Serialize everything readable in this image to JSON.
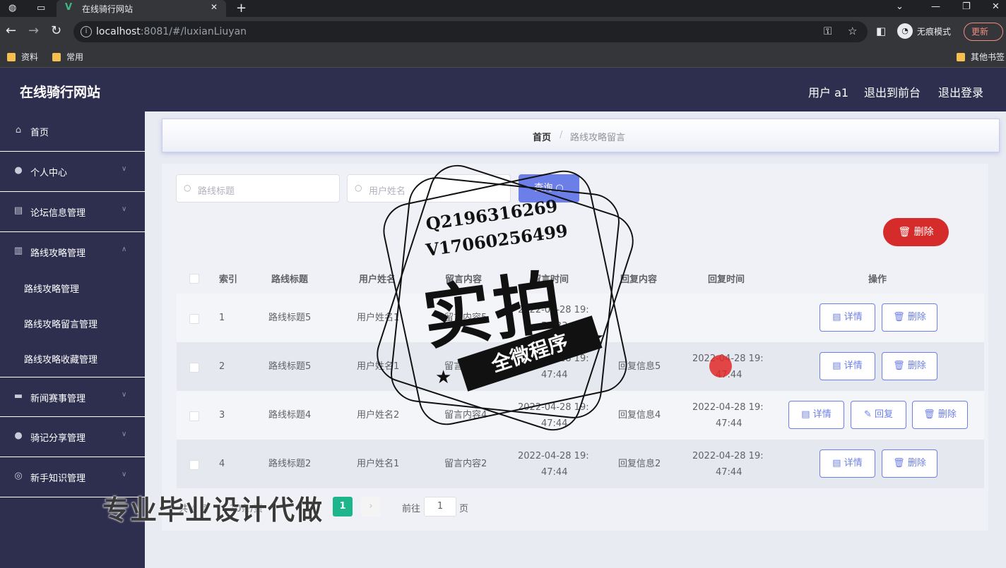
{
  "browser": {
    "tab_title": "在线骑行网站",
    "url_host": "localhost",
    "url_rest": ":8081/#/luxianLiuyan",
    "incognito_label": "无痕模式",
    "update_label": "更新",
    "bookmarks": [
      "资料",
      "常用"
    ],
    "other_bookmarks": "其他书签"
  },
  "header": {
    "site_title": "在线骑行网站",
    "user": "用户 a1",
    "to_front": "退出到前台",
    "logout": "退出登录"
  },
  "sidebar": {
    "items": [
      {
        "label": "首页",
        "icon": "home-icon"
      },
      {
        "label": "个人中心",
        "icon": "user-icon"
      },
      {
        "label": "论坛信息管理",
        "icon": "briefcase-icon"
      },
      {
        "label": "路线攻略管理",
        "icon": "book-icon"
      },
      {
        "label": "新闻赛事管理",
        "icon": "chat-icon"
      },
      {
        "label": "骑记分享管理",
        "icon": "bulb-icon"
      },
      {
        "label": "新手知识管理",
        "icon": "compass-icon"
      }
    ],
    "subitems": [
      "路线攻略管理",
      "路线攻略留言管理",
      "路线攻略收藏管理"
    ]
  },
  "breadcrumb": {
    "home": "首页",
    "separator": "/",
    "current": "路线攻略留言"
  },
  "search": {
    "title_placeholder": "路线标题",
    "user_placeholder": "用户姓名",
    "query_label": "查询",
    "delete_label": "删除"
  },
  "table": {
    "headers": [
      "索引",
      "路线标题",
      "用户姓名",
      "留言内容",
      "留言时间",
      "回复内容",
      "回复时间",
      "操作"
    ],
    "rows": [
      {
        "index": "1",
        "title": "路线标题5",
        "user": "用户姓名1",
        "message": "留言内容5",
        "msg_time_1": "2022-04-28 19:",
        "msg_time_2": "56:33",
        "reply": "",
        "reply_time_1": "",
        "reply_time_2": "",
        "buttons": [
          "详情",
          "删除"
        ]
      },
      {
        "index": "2",
        "title": "路线标题5",
        "user": "用户姓名1",
        "message": "留言内容5",
        "msg_time_1": "2022-04-28 19:",
        "msg_time_2": "47:44",
        "reply": "回复信息5",
        "reply_time_1": "2022-04-28 19:",
        "reply_time_2": "47:44",
        "buttons": [
          "详情",
          "删除"
        ]
      },
      {
        "index": "3",
        "title": "路线标题4",
        "user": "用户姓名2",
        "message": "留言内容4",
        "msg_time_1": "2022-04-28 19:",
        "msg_time_2": "47:44",
        "reply": "回复信息4",
        "reply_time_1": "2022-04-28 19:",
        "reply_time_2": "47:44",
        "buttons": [
          "详情",
          "回复",
          "删除"
        ]
      },
      {
        "index": "4",
        "title": "路线标题2",
        "user": "用户姓名1",
        "message": "留言内容2",
        "msg_time_1": "2022-04-28 19:",
        "msg_time_2": "47:44",
        "reply": "回复信息2",
        "reply_time_1": "2022-04-28 19:",
        "reply_time_2": "47:44",
        "buttons": [
          "详情",
          "删除"
        ]
      }
    ]
  },
  "pager": {
    "total": "共 4 条",
    "page_size": "10条/页",
    "current": "1",
    "goto": "前往",
    "goto_value": "1",
    "page_unit": "页"
  },
  "overlay": {
    "qq": "Q2196316269",
    "vx": "V17060256499",
    "stamp_big": "实拍",
    "stamp_ribbon": "全微程序",
    "watermark": "专业毕业设计代做"
  },
  "colors": {
    "sidebar_bg": "#2e2f4f",
    "primary": "#6c7fe8",
    "danger": "#d62b2b",
    "pager_active": "#1db58c"
  }
}
